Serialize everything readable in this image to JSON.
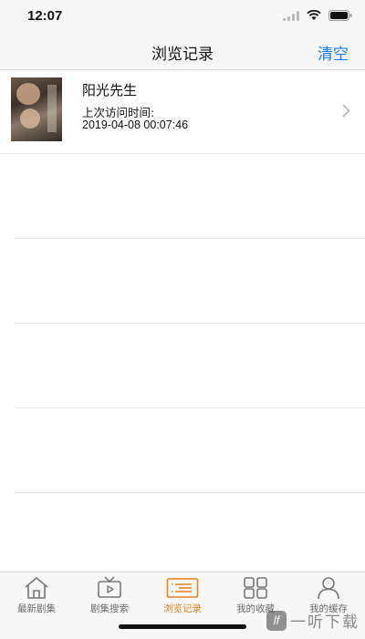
{
  "status_bar": {
    "time": "12:07"
  },
  "nav": {
    "title": "浏览记录",
    "clear_label": "清空"
  },
  "history": [
    {
      "title": "阳光先生",
      "meta_label": "上次访问时间:",
      "meta_time": "2019-04-08 00:07:46"
    }
  ],
  "tabs": [
    {
      "label": "最新剧集",
      "icon": "home-icon",
      "active": false
    },
    {
      "label": "剧集搜索",
      "icon": "tv-icon",
      "active": false
    },
    {
      "label": "浏览记录",
      "icon": "list-icon",
      "active": true
    },
    {
      "label": "我的收藏",
      "icon": "grid-icon",
      "active": false
    },
    {
      "label": "我的缓存",
      "icon": "person-icon",
      "active": false
    }
  ],
  "watermark": {
    "logo": "lf",
    "text": "一听下载"
  },
  "colors": {
    "accent": "#e8821a",
    "link": "#1a7de6",
    "inactive": "#6b6b6b"
  }
}
